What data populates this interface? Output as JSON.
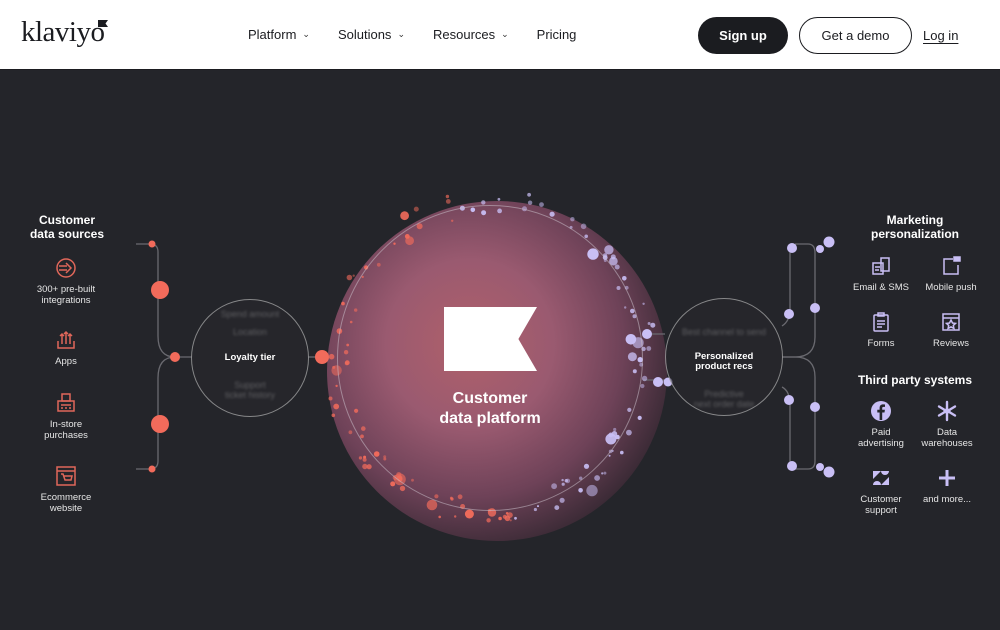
{
  "header": {
    "logo": "klaviyo",
    "nav": [
      {
        "label": "Platform",
        "has_dropdown": true
      },
      {
        "label": "Solutions",
        "has_dropdown": true
      },
      {
        "label": "Resources",
        "has_dropdown": true
      },
      {
        "label": "Pricing",
        "has_dropdown": false
      }
    ],
    "signup_label": "Sign up",
    "demo_label": "Get a demo",
    "login_label": "Log in"
  },
  "diagram": {
    "colors": {
      "source": "#f26b5b",
      "destination": "#c9bff5",
      "background": "#24252a"
    },
    "sources": {
      "heading_line1": "Customer",
      "heading_line2": "data sources",
      "items": [
        {
          "icon": "integrations-arrow-icon",
          "line1": "300+ pre-built",
          "line2": "integrations"
        },
        {
          "icon": "apps-upload-icon",
          "line1": "Apps",
          "line2": ""
        },
        {
          "icon": "register-printer-icon",
          "line1": "In-store",
          "line2": "purchases"
        },
        {
          "icon": "shopping-cart-icon",
          "line1": "Ecommerce",
          "line2": "website"
        }
      ]
    },
    "left_ring": {
      "label": "Loyalty tier",
      "blur_above": "Location",
      "blur_top": "Spend amount",
      "blur_below1": "Support",
      "blur_below2": "ticket history"
    },
    "center": {
      "line1": "Customer",
      "line2": "data platform"
    },
    "right_ring": {
      "line1": "Personalized",
      "line2": "product recs",
      "blur_above": "Best channel to send",
      "blur_below1": "Predictive",
      "blur_below2": "next order date"
    },
    "marketing": {
      "heading_line1": "Marketing",
      "heading_line2": "personalization",
      "items": [
        {
          "icon": "email-sms-icon",
          "line1": "Email & SMS",
          "line2": ""
        },
        {
          "icon": "mobile-push-icon",
          "line1": "Mobile push",
          "line2": ""
        },
        {
          "icon": "forms-clipboard-icon",
          "line1": "Forms",
          "line2": ""
        },
        {
          "icon": "reviews-star-icon",
          "line1": "Reviews",
          "line2": ""
        }
      ]
    },
    "third_party": {
      "heading": "Third party systems",
      "items": [
        {
          "icon": "facebook-icon",
          "line1": "Paid",
          "line2": "advertising"
        },
        {
          "icon": "snowflake-icon",
          "line1": "Data",
          "line2": "warehouses"
        },
        {
          "icon": "zendesk-icon",
          "line1": "Customer",
          "line2": "support"
        },
        {
          "icon": "plus-icon",
          "line1": "and more...",
          "line2": ""
        }
      ]
    }
  }
}
